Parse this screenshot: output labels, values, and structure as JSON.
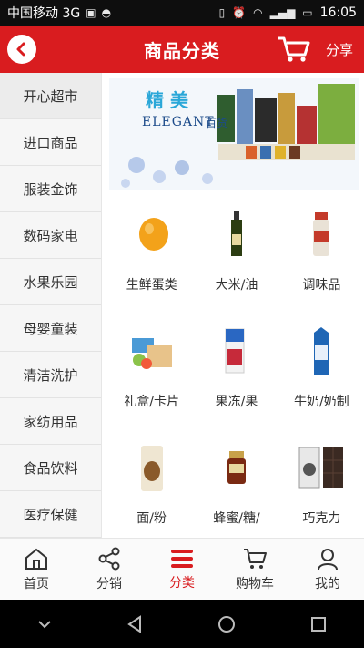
{
  "statusbar": {
    "carrier": "中国移动 3G",
    "time": "16:05"
  },
  "header": {
    "title": "商品分类",
    "share_label": "分享"
  },
  "sidebar": {
    "items": [
      {
        "label": "开心超市",
        "active": true
      },
      {
        "label": "进口商品",
        "active": false
      },
      {
        "label": "服装金饰",
        "active": false
      },
      {
        "label": "数码家电",
        "active": false
      },
      {
        "label": "水果乐园",
        "active": false
      },
      {
        "label": "母婴童装",
        "active": false
      },
      {
        "label": "清洁洗护",
        "active": false
      },
      {
        "label": "家纺用品",
        "active": false
      },
      {
        "label": "食品饮料",
        "active": false
      },
      {
        "label": "医疗保健",
        "active": false
      }
    ]
  },
  "banner": {
    "brand_cn": "精 美",
    "brand_en": "ELEGANT",
    "brand_tag": "百货"
  },
  "categories": [
    {
      "label": "生鲜蛋类"
    },
    {
      "label": "大米/油"
    },
    {
      "label": "调味品"
    },
    {
      "label": "礼盒/卡片"
    },
    {
      "label": "果冻/果"
    },
    {
      "label": "牛奶/奶制"
    },
    {
      "label": "面/粉"
    },
    {
      "label": "蜂蜜/糖/"
    },
    {
      "label": "巧克力"
    }
  ],
  "tabbar": {
    "items": [
      {
        "label": "首页",
        "icon": "home-icon"
      },
      {
        "label": "分销",
        "icon": "share-network-icon"
      },
      {
        "label": "分类",
        "icon": "category-menu-icon",
        "active": true
      },
      {
        "label": "购物车",
        "icon": "cart-icon"
      },
      {
        "label": "我的",
        "icon": "user-icon"
      }
    ]
  },
  "colors": {
    "brand_red": "#d91c1f",
    "status_bg": "#0e0e0e"
  }
}
